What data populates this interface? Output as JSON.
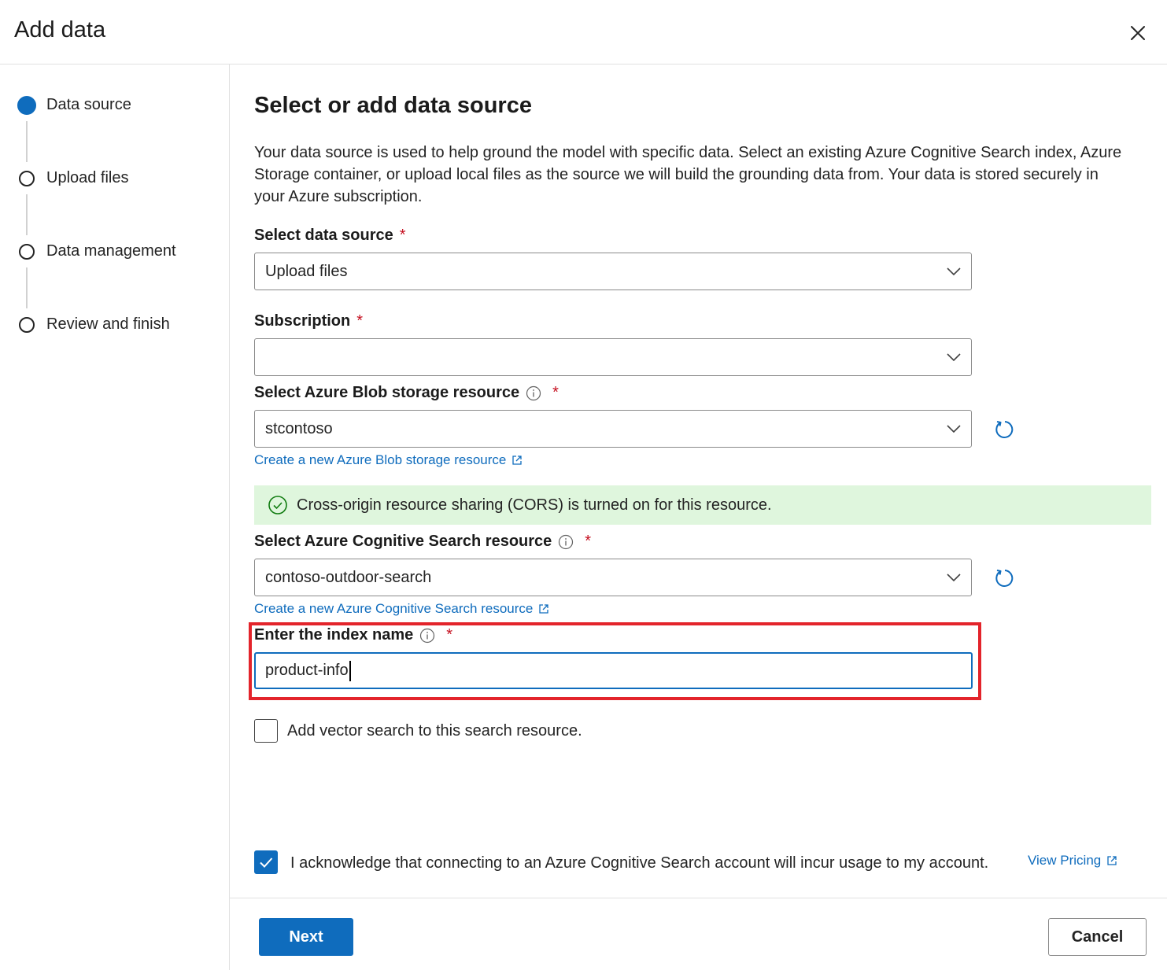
{
  "dialog": {
    "title": "Add data",
    "close_icon": "close-icon"
  },
  "steps": [
    {
      "label": "Data source",
      "state": "active"
    },
    {
      "label": "Upload files",
      "state": "inactive"
    },
    {
      "label": "Data management",
      "state": "inactive"
    },
    {
      "label": "Review and finish",
      "state": "inactive"
    }
  ],
  "main": {
    "title": "Select or add data source",
    "description": "Your data source is used to help ground the model with specific data. Select an existing Azure Cognitive Search index, Azure Storage container, or upload local files as the source we will build the grounding data from. Your data is stored securely in your Azure subscription."
  },
  "fields": {
    "data_source": {
      "label": "Select data source",
      "required": "*",
      "value": "Upload files"
    },
    "subscription": {
      "label": "Subscription",
      "required": "*",
      "value": ""
    },
    "blob": {
      "label": "Select Azure Blob storage resource",
      "required": "*",
      "value": "stcontoso",
      "link": "Create a new Azure Blob storage resource"
    },
    "cors_banner": "Cross-origin resource sharing (CORS) is turned on for this resource.",
    "search": {
      "label": "Select Azure Cognitive Search resource",
      "required": "*",
      "value": "contoso-outdoor-search",
      "link": "Create a new Azure Cognitive Search resource"
    },
    "index_name": {
      "label": "Enter the index name",
      "required": "*",
      "value": "product-info"
    }
  },
  "vector_search": {
    "label": "Add vector search to this search resource.",
    "checked": false
  },
  "acknowledge": {
    "label": "I acknowledge that connecting to an Azure Cognitive Search account will incur usage to my account.",
    "link": "View Pricing",
    "checked": true
  },
  "buttons": {
    "next": "Next",
    "cancel": "Cancel"
  },
  "colors": {
    "accent": "#0f6cbd",
    "success_bg": "#dff6dd",
    "success_icon": "#107c10",
    "highlight": "#e3242b",
    "required": "#c50f1f"
  }
}
